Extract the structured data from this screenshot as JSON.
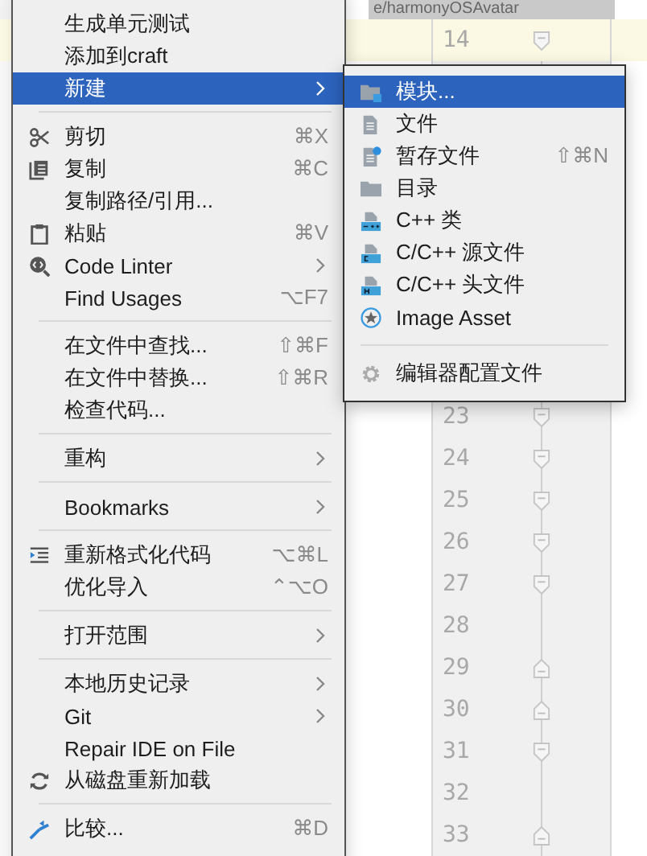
{
  "editor": {
    "breadcrumb": "e/harmonyOSAvatar",
    "gutter": [
      {
        "line": "14",
        "kind": "fold_start",
        "current": true
      },
      {
        "line": "23",
        "kind": "fold_start",
        "current": false
      },
      {
        "line": "24",
        "kind": "fold_start",
        "current": false
      },
      {
        "line": "25",
        "kind": "fold_start",
        "current": false
      },
      {
        "line": "26",
        "kind": "fold_start",
        "current": false
      },
      {
        "line": "27",
        "kind": "fold_start",
        "current": false
      },
      {
        "line": "28",
        "kind": "plain",
        "current": false
      },
      {
        "line": "29",
        "kind": "fold_end",
        "current": false
      },
      {
        "line": "30",
        "kind": "fold_end",
        "current": false
      },
      {
        "line": "31",
        "kind": "fold_start",
        "current": false
      },
      {
        "line": "32",
        "kind": "plain",
        "current": false
      },
      {
        "line": "33",
        "kind": "fold_end",
        "current": false
      }
    ]
  },
  "context_menu": {
    "items": [
      {
        "kind": "item",
        "label": "生成单元测试",
        "selected": false,
        "submenu": false
      },
      {
        "kind": "item",
        "label": "添加到craft",
        "selected": false,
        "submenu": false
      },
      {
        "kind": "item",
        "label": "新建",
        "selected": true,
        "submenu": true
      },
      {
        "kind": "separator"
      },
      {
        "kind": "item",
        "label": "剪切",
        "shortcut": "⌘X",
        "selected": false,
        "submenu": false
      },
      {
        "kind": "item",
        "label": "复制",
        "shortcut": "⌘C",
        "selected": false,
        "submenu": false
      },
      {
        "kind": "item",
        "label": "复制路径/引用...",
        "selected": false,
        "submenu": false
      },
      {
        "kind": "item",
        "label": "粘贴",
        "shortcut": "⌘V",
        "selected": false,
        "submenu": false
      },
      {
        "kind": "item",
        "label": "Code Linter",
        "selected": false,
        "submenu": true
      },
      {
        "kind": "item",
        "label": "Find Usages",
        "shortcut": "⌥F7",
        "selected": false,
        "submenu": false
      },
      {
        "kind": "separator"
      },
      {
        "kind": "item",
        "label": "在文件中查找...",
        "shortcut": "⇧⌘F",
        "selected": false,
        "submenu": false
      },
      {
        "kind": "item",
        "label": "在文件中替换...",
        "shortcut": "⇧⌘R",
        "selected": false,
        "submenu": false
      },
      {
        "kind": "item",
        "label": "检查代码...",
        "selected": false,
        "submenu": false
      },
      {
        "kind": "separator"
      },
      {
        "kind": "item",
        "label": "重构",
        "selected": false,
        "submenu": true
      },
      {
        "kind": "separator"
      },
      {
        "kind": "item",
        "label": "Bookmarks",
        "selected": false,
        "submenu": true
      },
      {
        "kind": "separator"
      },
      {
        "kind": "item",
        "label": "重新格式化代码",
        "shortcut": "⌥⌘L",
        "selected": false,
        "submenu": false
      },
      {
        "kind": "item",
        "label": "优化导入",
        "shortcut": "⌃⌥O",
        "selected": false,
        "submenu": false
      },
      {
        "kind": "separator"
      },
      {
        "kind": "item",
        "label": "打开范围",
        "selected": false,
        "submenu": true
      },
      {
        "kind": "separator"
      },
      {
        "kind": "item",
        "label": "本地历史记录",
        "selected": false,
        "submenu": true
      },
      {
        "kind": "item",
        "label": "Git",
        "selected": false,
        "submenu": true
      },
      {
        "kind": "item",
        "label": "Repair IDE on File",
        "selected": false,
        "submenu": false
      },
      {
        "kind": "item",
        "label": "从磁盘重新加载",
        "selected": false,
        "submenu": false
      },
      {
        "kind": "separator"
      },
      {
        "kind": "item",
        "label": "比较...",
        "shortcut": "⌘D",
        "selected": false,
        "submenu": false
      }
    ]
  },
  "new_submenu": {
    "items": [
      {
        "kind": "item",
        "label": "模块...",
        "selected": true
      },
      {
        "kind": "item",
        "label": "文件",
        "selected": false
      },
      {
        "kind": "item",
        "label": "暂存文件",
        "shortcut": "⇧⌘N",
        "selected": false
      },
      {
        "kind": "item",
        "label": "目录",
        "selected": false
      },
      {
        "kind": "item",
        "label": "C++ 类",
        "selected": false
      },
      {
        "kind": "item",
        "label": "C/C++ 源文件",
        "selected": false
      },
      {
        "kind": "item",
        "label": "C/C++ 头文件",
        "selected": false
      },
      {
        "kind": "item",
        "label": "Image Asset",
        "selected": false
      },
      {
        "kind": "separator"
      },
      {
        "kind": "item",
        "label": "编辑器配置文件",
        "selected": false
      }
    ]
  }
}
